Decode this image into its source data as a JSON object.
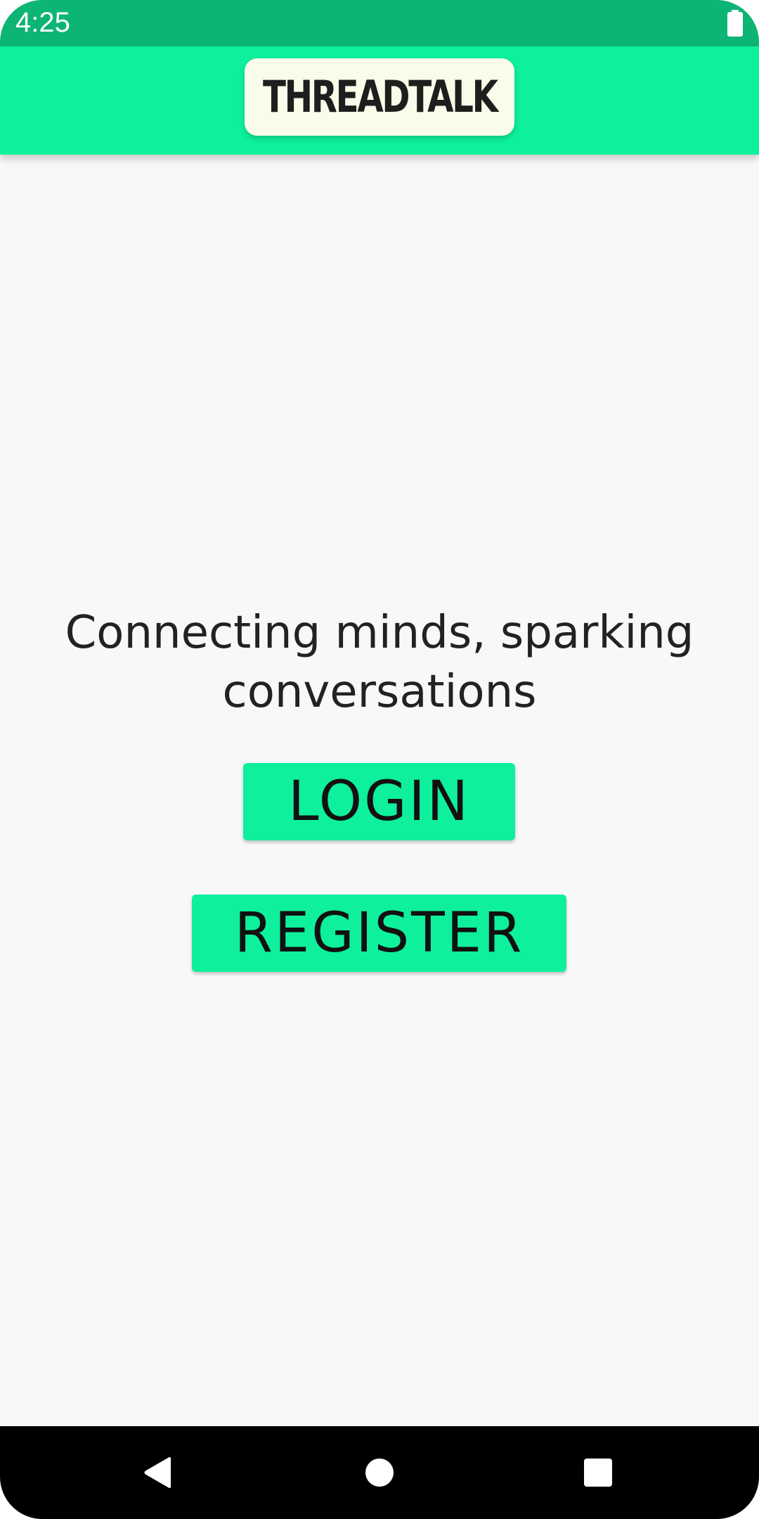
{
  "status_bar": {
    "time": "4:25",
    "battery_icon": "battery-full-icon",
    "background_color": "#0db574"
  },
  "app_bar": {
    "logo_text": "THREADTALK",
    "background_color": "#0ef09c",
    "logo_card_color": "#fbfbe9"
  },
  "main": {
    "tagline": "Connecting minds, sparking conversations",
    "login_label": "LOGIN",
    "register_label": "REGISTER",
    "button_color": "#0ef09c"
  },
  "nav_bar": {
    "back_icon": "back-triangle-icon",
    "home_icon": "home-circle-icon",
    "recents_icon": "recents-square-icon"
  }
}
